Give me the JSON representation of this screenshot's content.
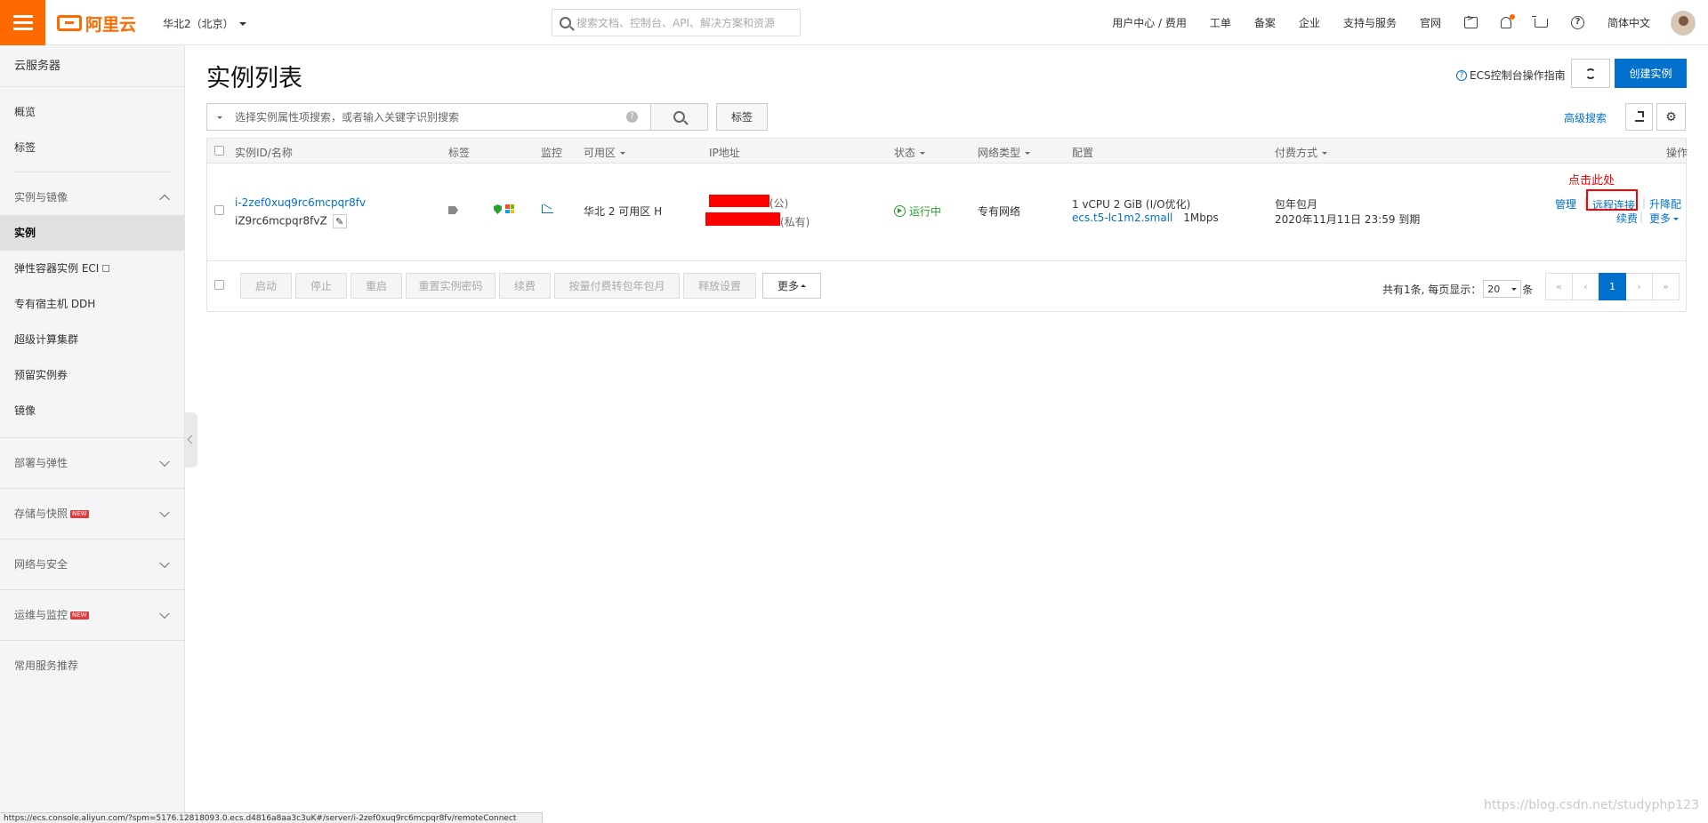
{
  "topbar": {
    "logo": "阿里云",
    "region": "华北2（北京）",
    "search_placeholder": "搜索文档、控制台、API、解决方案和资源",
    "nav": [
      "用户中心 / 费用",
      "工单",
      "备案",
      "企业",
      "支持与服务",
      "官网"
    ],
    "lang": "简体中文",
    "icons": [
      "terminal-icon",
      "bell-icon",
      "cart-icon",
      "help-icon"
    ]
  },
  "sidebar": {
    "title": "云服务器",
    "top_items": [
      "概览",
      "标签"
    ],
    "section_label": "实例与镜像",
    "section_items": [
      "实例",
      "弹性容器实例 ECI",
      "专有宿主机 DDH",
      "超级计算集群",
      "预留实例券",
      "镜像"
    ],
    "active_item": "实例",
    "groups": [
      {
        "label": "部署与弹性",
        "badge": ""
      },
      {
        "label": "存储与快照",
        "badge": "NEW"
      },
      {
        "label": "网络与安全",
        "badge": ""
      },
      {
        "label": "运维与监控",
        "badge": "NEW"
      }
    ],
    "footer": "常用服务推荐"
  },
  "header": {
    "title": "实例列表",
    "guide": "ECS控制台操作指南",
    "create": "创建实例"
  },
  "toolbar": {
    "filter_placeholder": "选择实例属性项搜索，或者输入关键字识别搜索",
    "tag_button": "标签",
    "advanced_search": "高级搜索"
  },
  "table": {
    "columns": [
      "实例ID/名称",
      "标签",
      "监控",
      "可用区",
      "IP地址",
      "状态",
      "网络类型",
      "配置",
      "付费方式",
      "操作"
    ],
    "row": {
      "instance_id": "i-2zef0xuq9rc6mcpqr8fv",
      "instance_name": "iZ9rc6mcpqr8fvZ",
      "zone": "华北 2 可用区 H",
      "ip_public_suffix": "(公)",
      "ip_private_suffix": "(私有)",
      "status": "运行中",
      "network": "专有网络",
      "config_line1": "1 vCPU 2 GiB (I/O优化)",
      "config_type": "ecs.t5-lc1m2.small",
      "config_bandwidth": "1Mbps",
      "billing_type": "包年包月",
      "billing_expire": "2020年11月11日 23:59 到期",
      "ops": {
        "manage": "管理",
        "remote": "远程连接",
        "resize": "升降配",
        "renew": "续费",
        "more": "更多"
      }
    },
    "annotation": "点击此处"
  },
  "footer": {
    "batch_buttons": [
      "启动",
      "停止",
      "重启",
      "重置实例密码",
      "续费",
      "按量付费转包年包月",
      "释放设置"
    ],
    "more": "更多",
    "total": "共有1条, 每页显示：",
    "page_size": "20",
    "unit": "条",
    "pager": [
      "«",
      "‹",
      "1",
      "›",
      "»"
    ],
    "current_page": "1"
  },
  "browser": {
    "status_url": "https://ecs.console.aliyun.com/?spm=5176.12818093.0.ecs.d4816a8aa3c3uK#/server/i-2zef0xuq9rc6mcpqr8fv/remoteConnect",
    "watermark": "https://blog.csdn.net/studyphp123"
  },
  "colors": {
    "accent": "#ff6a00",
    "primary": "#0070cc",
    "running": "#27a22e",
    "annotation": "#ff0000"
  }
}
